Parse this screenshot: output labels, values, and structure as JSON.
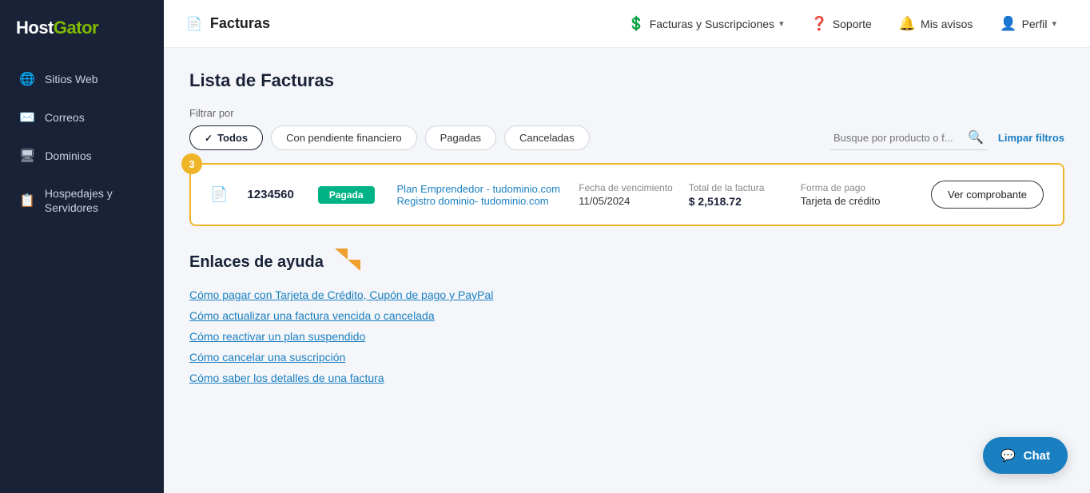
{
  "sidebar": {
    "logo": "HostGator",
    "items": [
      {
        "id": "sitios-web",
        "label": "Sitios Web",
        "icon": "🌐"
      },
      {
        "id": "correos",
        "label": "Correos",
        "icon": "✉️"
      },
      {
        "id": "dominios",
        "label": "Dominios",
        "icon": "🖥"
      },
      {
        "id": "hospedajes",
        "label": "Hospedajes y Servidores",
        "icon": "📋"
      }
    ]
  },
  "topnav": {
    "page_icon": "📄",
    "page_title": "Facturas",
    "links": [
      {
        "label": "Facturas y Suscripciones",
        "has_chevron": true
      },
      {
        "label": "Soporte",
        "has_chevron": false
      },
      {
        "label": "Mis avisos",
        "has_chevron": false
      },
      {
        "label": "Perfil",
        "has_chevron": true
      }
    ]
  },
  "main": {
    "page_title": "Lista de Facturas",
    "filter": {
      "label": "Filtrar por",
      "options": [
        {
          "label": "Todos",
          "active": true
        },
        {
          "label": "Con pendiente financiero",
          "active": false
        },
        {
          "label": "Pagadas",
          "active": false
        },
        {
          "label": "Canceladas",
          "active": false
        }
      ],
      "search_placeholder": "Busque por producto o f...",
      "clear_label": "Limpar filtros"
    },
    "step_badge": "3",
    "invoice": {
      "id": "1234560",
      "status": "Pagada",
      "lines": [
        "Plan Emprendedor - tudominio.com",
        "Registro dominio- tudominio.com"
      ],
      "fecha_label": "Fecha de vencimiento",
      "fecha_value": "11/05/2024",
      "total_label": "Total de la factura",
      "total_value": "$ 2,518.72",
      "pago_label": "Forma de pago",
      "pago_value": "Tarjeta de crédito",
      "btn_label": "Ver comprobante"
    },
    "help": {
      "title": "Enlaces de ayuda",
      "links": [
        "Cómo pagar con Tarjeta de Crédito, Cupón de pago y PayPal",
        "Cómo actualizar una factura vencida o cancelada",
        "Cómo reactivar un plan suspendido",
        "Cómo cancelar una suscripción",
        "Cómo saber los detalles de una factura"
      ]
    },
    "chat_label": "Chat"
  }
}
